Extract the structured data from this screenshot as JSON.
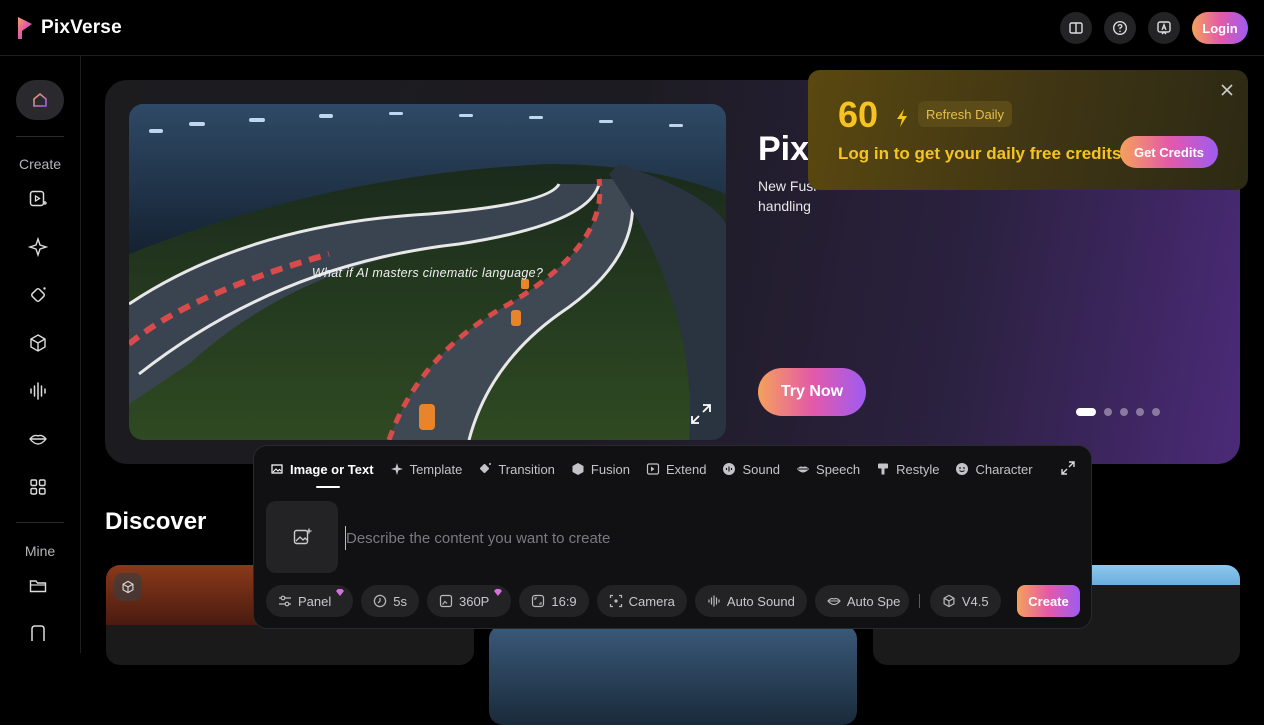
{
  "brand": {
    "name": "PixVerse"
  },
  "header": {
    "login_label": "Login",
    "icons": [
      "book-icon",
      "help-icon",
      "feedback-icon"
    ]
  },
  "sidebar": {
    "create_label": "Create",
    "mine_label": "Mine",
    "items": [
      "home-icon",
      "video-icon",
      "sparkle-icon",
      "effects-icon",
      "fusion-icon",
      "sound-icon",
      "lips-icon",
      "apps-icon",
      "folder-icon",
      "bookmark-icon"
    ]
  },
  "hero": {
    "video_caption": "What if AI masters cinematic language?",
    "title": "PixV",
    "description": "New Fusi… handling",
    "description_line1": "New Fusi",
    "description_line2": "handling",
    "cta_label": "Try Now",
    "slides_count": 5,
    "active_slide": 1
  },
  "promo": {
    "credits": "60",
    "refresh_label": "Refresh Daily",
    "message": "Log in to get your daily free credits",
    "button_label": "Get Credits"
  },
  "discover": {
    "title": "Discover"
  },
  "creator": {
    "tabs": [
      {
        "label": "Image or Text",
        "icon": "image-icon",
        "active": true
      },
      {
        "label": "Template",
        "icon": "sparkle-icon"
      },
      {
        "label": "Transition",
        "icon": "transition-icon"
      },
      {
        "label": "Fusion",
        "icon": "cube-icon"
      },
      {
        "label": "Extend",
        "icon": "extend-icon"
      },
      {
        "label": "Sound",
        "icon": "sound-icon"
      },
      {
        "label": "Speech",
        "icon": "lips-icon"
      },
      {
        "label": "Restyle",
        "icon": "brush-icon"
      },
      {
        "label": "Character",
        "icon": "face-icon"
      }
    ],
    "prompt_placeholder": "Describe the content you want to create",
    "controls": {
      "panel": "Panel",
      "duration": "5s",
      "resolution": "360P",
      "aspect": "16:9",
      "camera": "Camera",
      "auto_sound": "Auto Sound",
      "auto_speech": "Auto Spe",
      "model": "V4.5"
    },
    "create_label": "Create"
  },
  "colors": {
    "accent_gradient": [
      "#f5a15c",
      "#e35aa8",
      "#9e5bf2"
    ],
    "promo_gold": "#f7c321"
  }
}
